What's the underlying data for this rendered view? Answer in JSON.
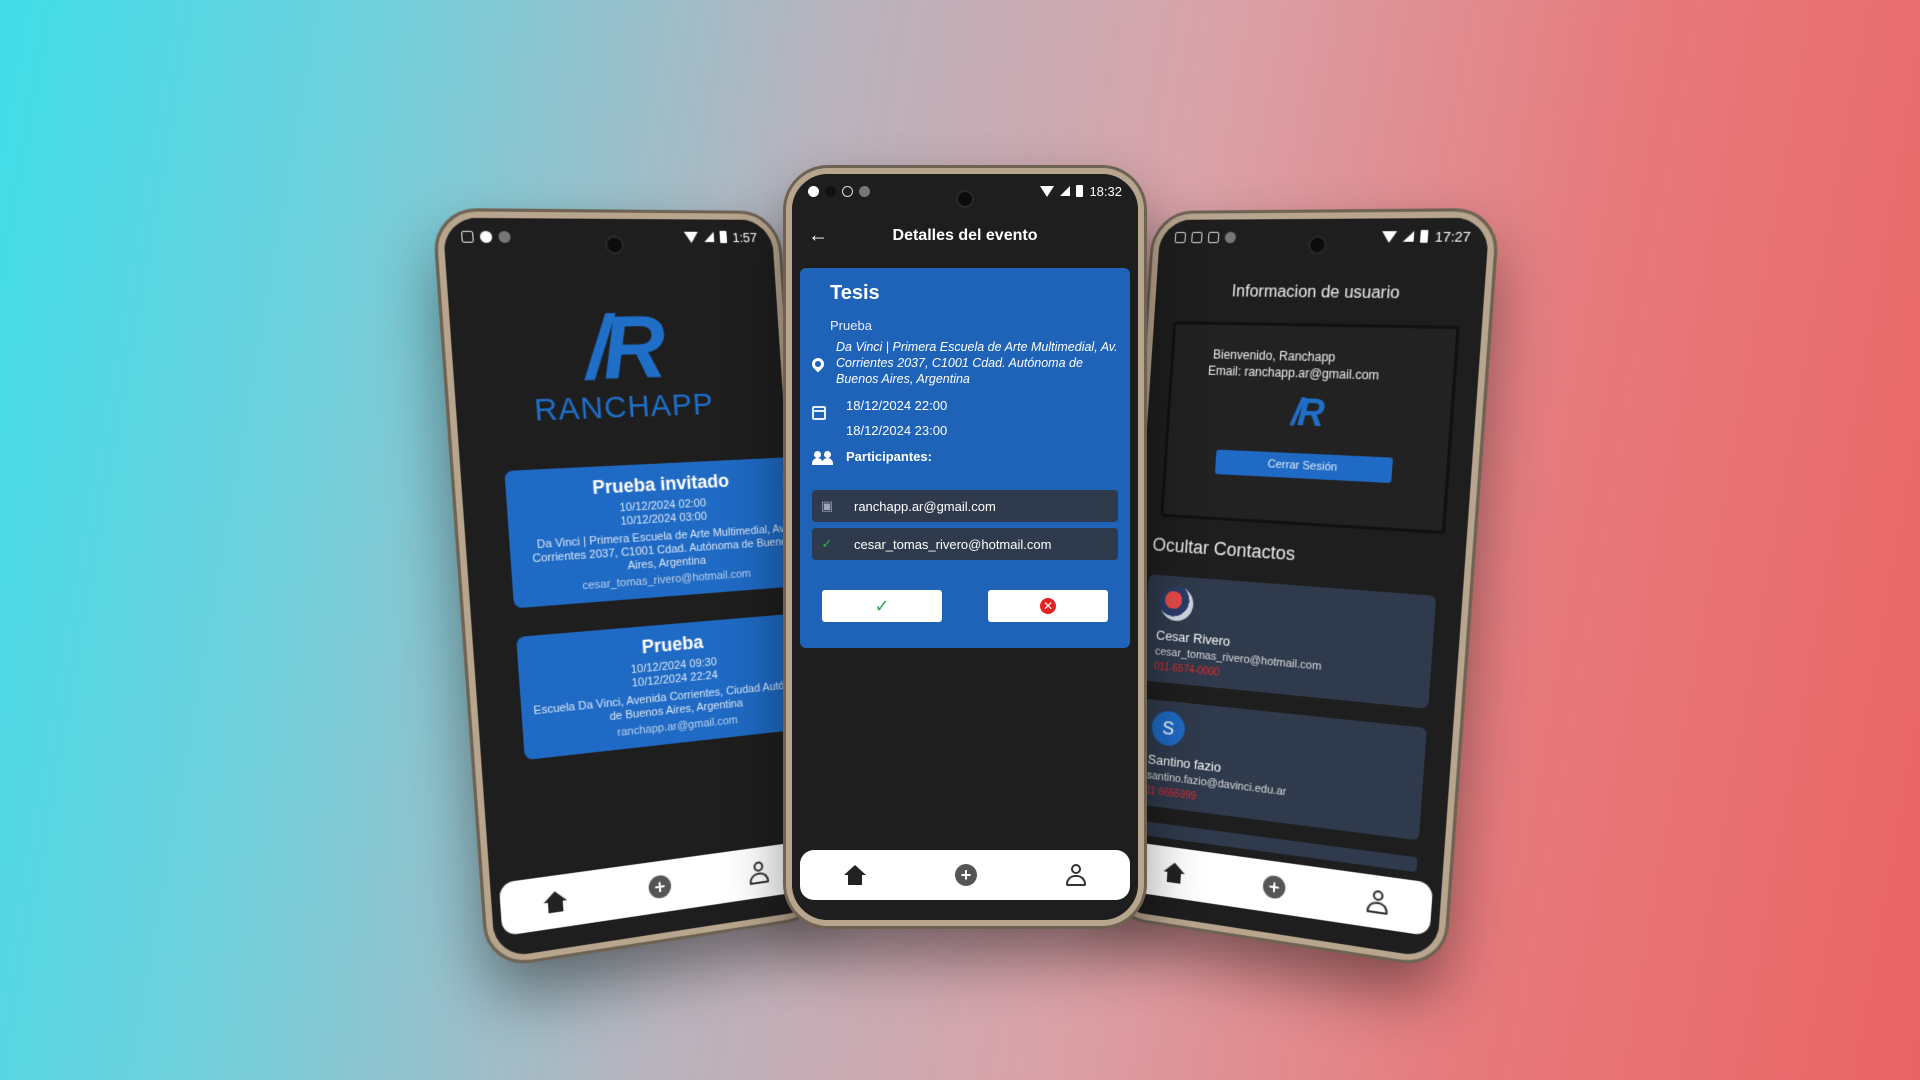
{
  "left_phone": {
    "status_time": "1:57",
    "logo_text": "RANCHAPP",
    "events": [
      {
        "title": "Prueba invitado",
        "start": "10/12/2024 02:00",
        "end": "10/12/2024 03:00",
        "address": "Da Vinci | Primera Escuela de Arte Multimedial, Av. Corrientes 2037, C1001 Cdad. Autónoma de Buenos Aires, Argentina",
        "email": "cesar_tomas_rivero@hotmail.com"
      },
      {
        "title": "Prueba",
        "start": "10/12/2024 09:30",
        "end": "10/12/2024 22:24",
        "address": "Escuela Da Vinci, Avenida Corrientes, Ciudad Autónoma de Buenos Aires, Argentina",
        "email": "ranchapp.ar@gmail.com"
      }
    ]
  },
  "center_phone": {
    "status_time": "18:32",
    "header_title": "Detalles del evento",
    "event": {
      "title": "Tesis",
      "description": "Prueba",
      "address": "Da Vinci | Primera Escuela de Arte Multimedial, Av. Corrientes 2037, C1001 Cdad. Autónoma de Buenos Aires, Argentina",
      "start": "18/12/2024 22:00",
      "end": "18/12/2024 23:00",
      "participants_label": "Participantes:",
      "participants": [
        {
          "email": "ranchapp.ar@gmail.com",
          "status": "pending"
        },
        {
          "email": "cesar_tomas_rivero@hotmail.com",
          "status": "accepted"
        }
      ]
    },
    "accent_color": "#1e63b8"
  },
  "right_phone": {
    "status_time": "17:27",
    "title": "Informacion de usuario",
    "welcome": "Bienvenido, Ranchapp",
    "email": "Email: ranchapp.ar@gmail.com",
    "logout_label": "Cerrar Sesión",
    "hide_contacts_label": "Ocultar Contactos",
    "contacts": [
      {
        "name": "Cesar Rivero",
        "email": "cesar_tomas_rivero@hotmail.com",
        "extra": "011-6574-0000",
        "avatar": "photo"
      },
      {
        "name": "Santino fazio",
        "email": "santino.fazio@davinci.edu.ar",
        "extra": "11 6655999",
        "avatar": "S"
      }
    ]
  }
}
